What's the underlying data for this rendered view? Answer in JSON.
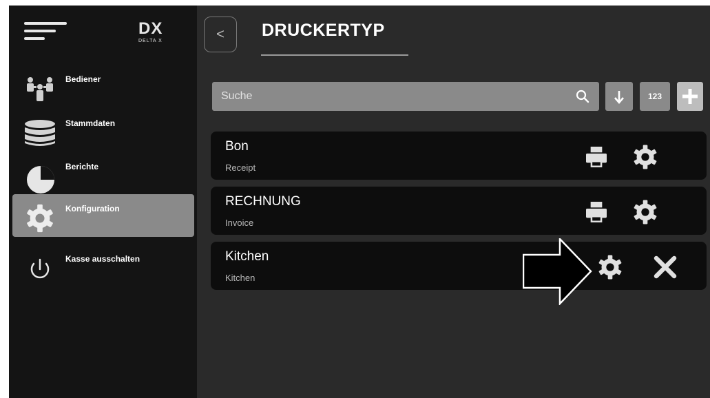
{
  "brand": {
    "logo": "DX",
    "logo_sub": "DELTA X"
  },
  "sidebar": {
    "items": [
      {
        "label": "Bediener",
        "icon": "users-icon"
      },
      {
        "label": "Stammdaten",
        "icon": "database-icon"
      },
      {
        "label": "Berichte",
        "icon": "pie-chart-icon"
      },
      {
        "label": "Konfiguration",
        "icon": "gear-icon",
        "active": true
      },
      {
        "label": "Kasse ausschalten",
        "icon": "power-icon"
      }
    ]
  },
  "header": {
    "back": "<",
    "title": "DRUCKERTYP"
  },
  "toolbar": {
    "search_placeholder": "Suche",
    "sort_icon": "arrow-down-icon",
    "num_label": "123",
    "add_icon": "plus-icon"
  },
  "rows": [
    {
      "title": "Bon",
      "subtitle": "Receipt",
      "actions": [
        "printer-icon",
        "gear-icon"
      ]
    },
    {
      "title": "RECHNUNG",
      "subtitle": "Invoice",
      "actions": [
        "printer-icon",
        "gear-icon"
      ]
    },
    {
      "title": "Kitchen",
      "subtitle": "Kitchen",
      "actions": [
        "gear-icon",
        "close-icon"
      ]
    }
  ],
  "colors": {
    "background": "#2a2a2a",
    "sidebar": "#141414",
    "active_item": "#8a8a8a",
    "row": "#0d0d0d",
    "text": "#ffffff"
  }
}
